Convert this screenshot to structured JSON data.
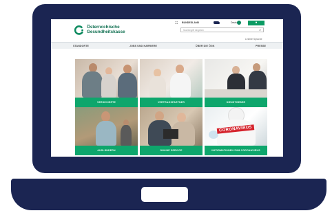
{
  "site": {
    "logo_line1": "Österreichische",
    "logo_line2": "Gesundheitskasse",
    "bundesland_label": "BUNDESLAND",
    "language": "Deutsch",
    "user_icon": "user-icon",
    "search_placeholder": "Suchbegriff eingeben",
    "easy_language": "Leichte Sprache"
  },
  "nav": {
    "items": [
      "STANDORTE",
      "JOBS UND KARRIERE",
      "ÜBER DIE ÖGK",
      "PRESSE"
    ]
  },
  "tiles": [
    {
      "label": "VERSICHERTE"
    },
    {
      "label": "VERTRAGSPARTNER"
    },
    {
      "label": "DIENSTGEBER"
    },
    {
      "label": "AUSLÄNDERN"
    },
    {
      "label": "ONLINE SERVICE"
    },
    {
      "label": "INFORMATIONEN ZUM CORONAVIRUS"
    }
  ],
  "corona_sign": "CORONAVIRUS",
  "colors": {
    "brand_green": "#0ea66c",
    "laptop_navy": "#1b2552"
  }
}
